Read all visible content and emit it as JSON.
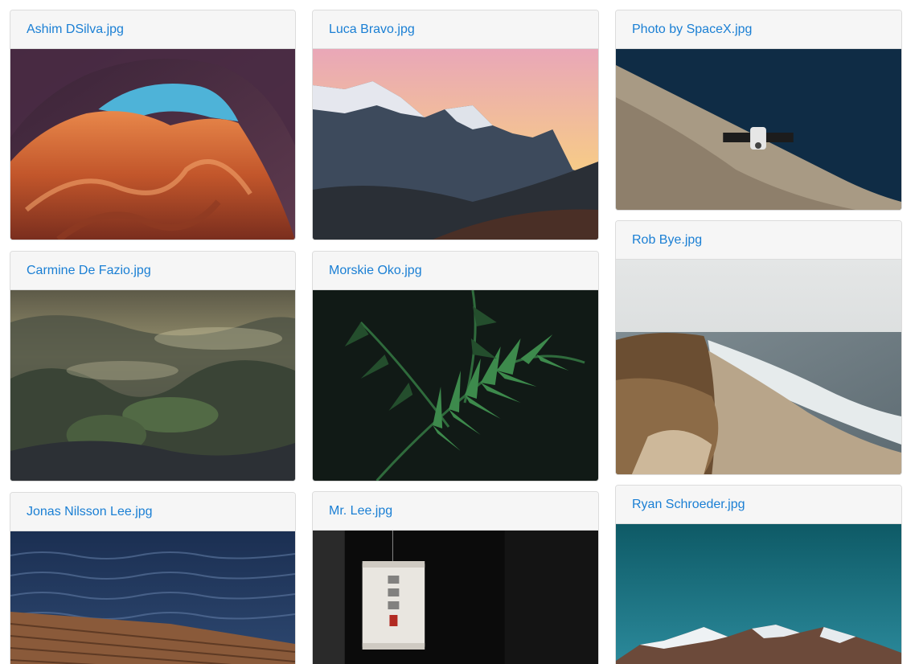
{
  "gallery": {
    "photos": [
      {
        "filename": "Ashim DSilva.jpg"
      },
      {
        "filename": "Luca Bravo.jpg"
      },
      {
        "filename": "Photo by SpaceX.jpg"
      },
      {
        "filename": "Carmine De Fazio.jpg"
      },
      {
        "filename": "Morskie Oko.jpg"
      },
      {
        "filename": "Rob Bye.jpg"
      },
      {
        "filename": "Jonas Nilsson Lee.jpg"
      },
      {
        "filename": "Mr. Lee.jpg"
      },
      {
        "filename": "Ryan Schroeder.jpg"
      }
    ]
  }
}
